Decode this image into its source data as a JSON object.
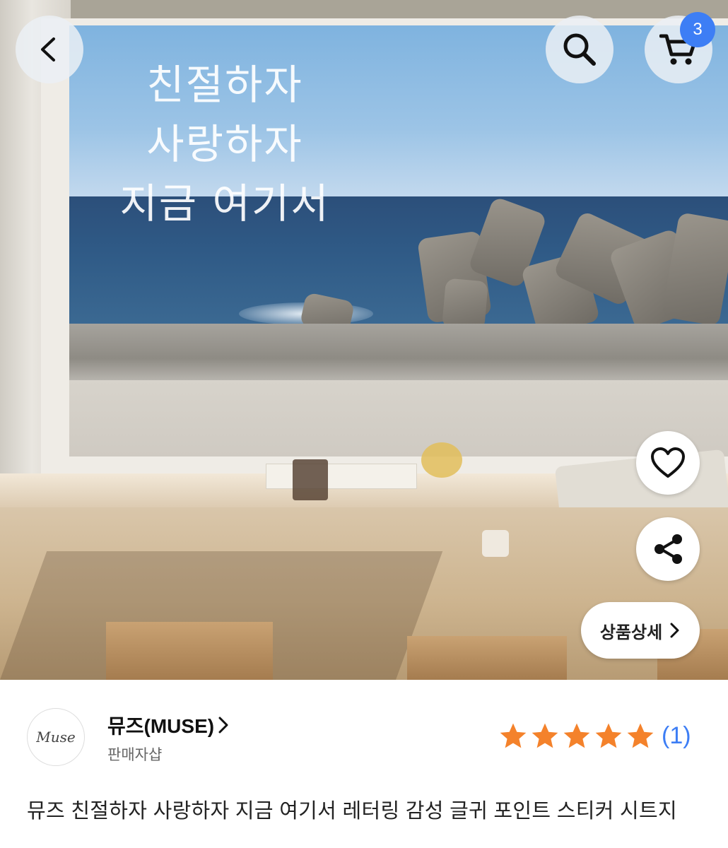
{
  "hero": {
    "overlay_text": "친절하자\n사랑하자\n지금 여기서"
  },
  "header": {
    "back_icon": "chevron-left-icon",
    "search_icon": "search-icon",
    "cart_icon": "cart-icon",
    "cart_badge": "3",
    "badge_color": "#3d7ef5"
  },
  "actions": {
    "like_icon": "heart-icon",
    "share_icon": "share-icon",
    "detail_label": "상품상세"
  },
  "seller": {
    "logo_text": "Muse",
    "name": "뮤즈(MUSE)",
    "type": "판매자샵"
  },
  "rating": {
    "stars": 5,
    "star_color": "#f4822b",
    "review_count": "(1)"
  },
  "product": {
    "title": "뮤즈 친절하자 사랑하자 지금 여기서 레터링 감성 글귀 포인트 스티커 시트지"
  }
}
